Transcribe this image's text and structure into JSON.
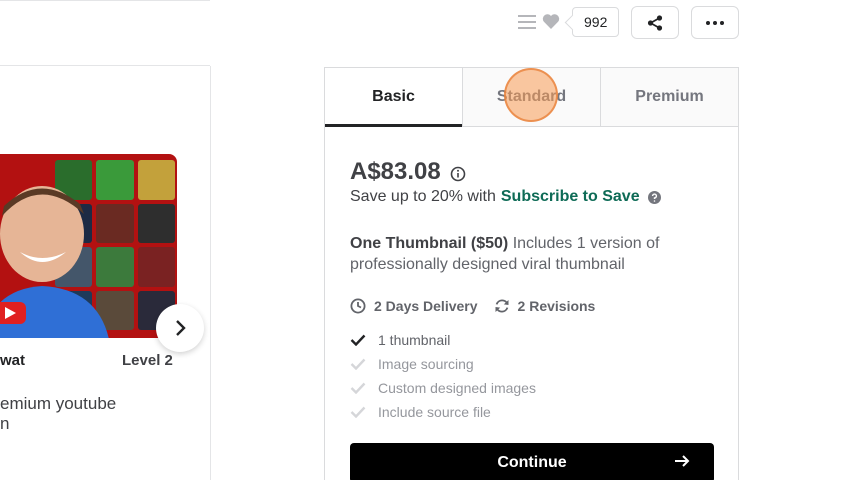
{
  "header": {
    "like_count": "992"
  },
  "gig": {
    "seller_name": "wat",
    "seller_level": "Level 2",
    "title_lines": [
      "emium youtube",
      "n"
    ]
  },
  "package": {
    "tabs": [
      {
        "label": "Basic",
        "active": true
      },
      {
        "label": "Standard",
        "active": false
      },
      {
        "label": "Premium",
        "active": false
      }
    ],
    "price": "A$83.08",
    "save_text": "Save up to 20% with",
    "save_link": "Subscribe to Save",
    "desc_bold": "One Thumbnail ($50)",
    "desc_rest": " Includes 1 version of professionally designed viral thumbnail",
    "delivery": "2 Days Delivery",
    "revisions": "2 Revisions",
    "features": [
      {
        "label": "1 thumbnail",
        "included": true
      },
      {
        "label": "Image sourcing",
        "included": false
      },
      {
        "label": "Custom designed images",
        "included": false
      },
      {
        "label": "Include source file",
        "included": false
      }
    ],
    "continue_label": "Continue"
  },
  "colors": {
    "accent_green": "#0e6b56",
    "text_dark": "#222325",
    "cursor": "#f79b54"
  },
  "icons": [
    "list-icon",
    "heart-icon",
    "share-icon",
    "more-icon",
    "info-icon",
    "help-icon",
    "clock-icon",
    "refresh-icon",
    "check-icon",
    "chevron-right-icon",
    "arrow-right-icon"
  ]
}
